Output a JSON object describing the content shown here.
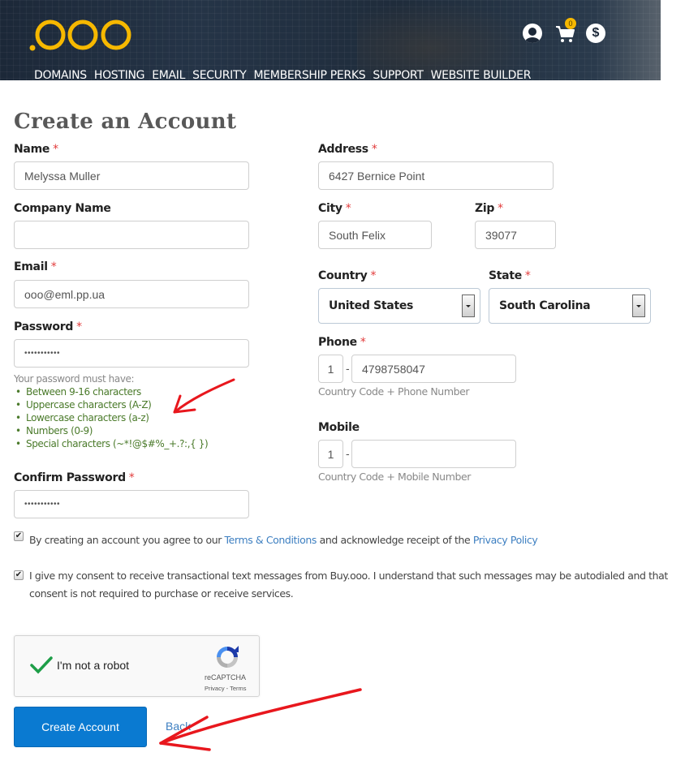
{
  "header": {
    "logo_text": ".ooo",
    "nav": [
      "DOMAINS",
      "HOSTING",
      "EMAIL",
      "SECURITY",
      "MEMBERSHIP PERKS",
      "SUPPORT",
      "WEBSITE BUILDER"
    ],
    "icons": [
      "user-icon",
      "cart-icon",
      "dollar-icon"
    ],
    "cart_count": "0",
    "dollar_symbol": "$"
  },
  "page": {
    "title": "Create an Account"
  },
  "form": {
    "required_mark": "*",
    "name": {
      "label": "Name",
      "value": "Melyssa Muller"
    },
    "company": {
      "label": "Company Name",
      "value": ""
    },
    "email": {
      "label": "Email",
      "value": "ooo@eml.pp.ua"
    },
    "password": {
      "label": "Password",
      "value": "•••••••••••"
    },
    "password_rules": {
      "intro": "Your password must have:",
      "items": [
        "Between 9-16 characters",
        "Uppercase characters (A-Z)",
        "Lowercase characters (a-z)",
        "Numbers (0-9)",
        "Special characters (~*!@$#%_+.?:,{ })"
      ]
    },
    "confirm_password": {
      "label": "Confirm Password",
      "value": "•••••••••••"
    },
    "address": {
      "label": "Address",
      "value": "6427 Bernice Point"
    },
    "city": {
      "label": "City",
      "value": "South Felix"
    },
    "zip": {
      "label": "Zip",
      "value": "39077"
    },
    "country": {
      "label": "Country",
      "value": "United States"
    },
    "state": {
      "label": "State",
      "value": "South Carolina"
    },
    "phone": {
      "label": "Phone",
      "country_code": "1",
      "separator": "-",
      "value": "4798758047",
      "hint": "Country Code + Phone Number"
    },
    "mobile": {
      "label": "Mobile",
      "country_code": "1",
      "separator": "-",
      "value": "",
      "hint": "Country Code + Mobile Number"
    },
    "terms": {
      "checked": true,
      "text_before": "By creating an account you agree to our ",
      "terms_link": "Terms & Conditions",
      "text_middle": " and acknowledge receipt of the ",
      "privacy_link": "Privacy Policy"
    },
    "sms_consent": {
      "checked": true,
      "text": "I give my consent to receive transactional text messages from Buy.ooo. I understand that such messages may be autodialed and that consent is not required to purchase or receive services."
    },
    "recaptcha": {
      "label": "I'm not a robot",
      "brand": "reCAPTCHA",
      "links": "Privacy - Terms",
      "verified": true
    },
    "submit_label": "Create Account",
    "back_label": "Back"
  },
  "colors": {
    "primary_button": "#0a7ad1",
    "link": "#3d7fc1",
    "required": "#e23b3b",
    "rules_green": "#4a7a2a",
    "logo_yellow": "#f6b800",
    "annotation_red": "#e8171d"
  }
}
